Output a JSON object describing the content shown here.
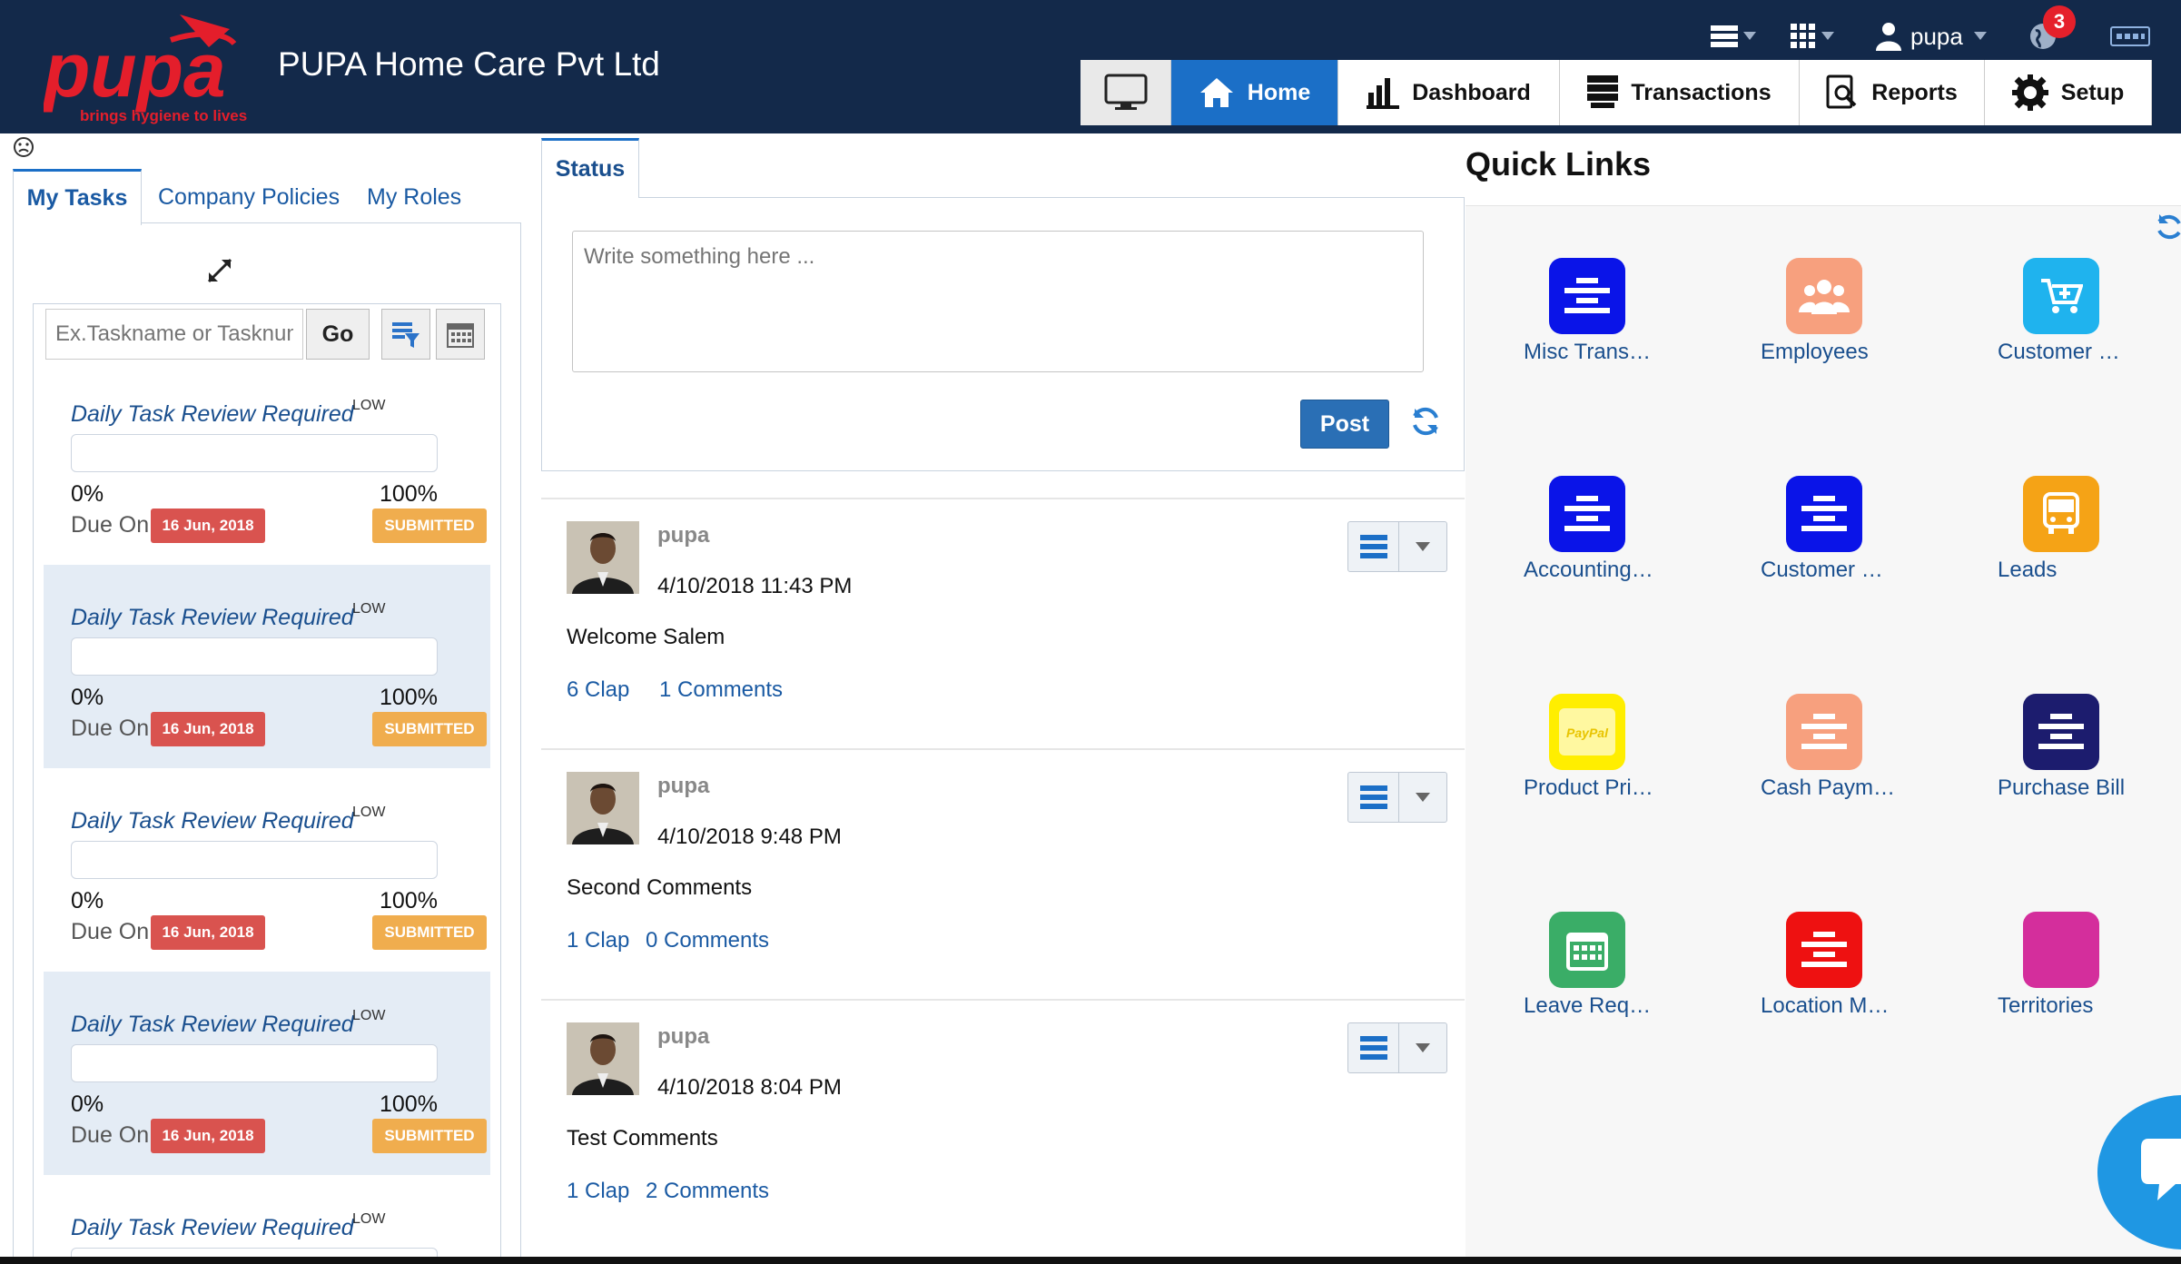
{
  "header": {
    "logo_text": "pupa",
    "logo_tagline": "brings hygiene to lives",
    "company": "PUPA Home Care Pvt Ltd",
    "username": "pupa",
    "notification_count": "3",
    "icons": [
      "list-menu-icon",
      "apps-grid-icon",
      "user-icon",
      "globe-icon",
      "keyboard-icon"
    ]
  },
  "nav": {
    "items": [
      {
        "label": "",
        "icon": "desktop-icon"
      },
      {
        "label": "Home",
        "icon": "home-icon"
      },
      {
        "label": "Dashboard",
        "icon": "bar-chart-icon"
      },
      {
        "label": "Transactions",
        "icon": "stack-icon"
      },
      {
        "label": "Reports",
        "icon": "report-search-icon"
      },
      {
        "label": "Setup",
        "icon": "gear-icon"
      }
    ],
    "active": "Home"
  },
  "left": {
    "tabs": [
      "My Tasks",
      "Company Policies",
      "My Roles"
    ],
    "search_placeholder": "Ex.Taskname or Tasknum",
    "go_label": "Go",
    "tasks": [
      {
        "title": "Daily Task Review Required",
        "priority": "LOW",
        "progress": 0,
        "min": "0%",
        "max": "100%",
        "due_label": "Due On",
        "due_date": "16 Jun, 2018",
        "status": "SUBMITTED"
      },
      {
        "title": "Daily Task Review Required",
        "priority": "LOW",
        "progress": 0,
        "min": "0%",
        "max": "100%",
        "due_label": "Due On",
        "due_date": "16 Jun, 2018",
        "status": "SUBMITTED"
      },
      {
        "title": "Daily Task Review Required",
        "priority": "LOW",
        "progress": 0,
        "min": "0%",
        "max": "100%",
        "due_label": "Due On",
        "due_date": "16 Jun, 2018",
        "status": "SUBMITTED"
      },
      {
        "title": "Daily Task Review Required",
        "priority": "LOW",
        "progress": 0,
        "min": "0%",
        "max": "100%",
        "due_label": "Due On",
        "due_date": "16 Jun, 2018",
        "status": "SUBMITTED"
      },
      {
        "title": "Daily Task Review Required",
        "priority": "LOW",
        "progress": 0,
        "min": "",
        "max": "",
        "due_label": "",
        "due_date": "",
        "status": ""
      }
    ]
  },
  "status": {
    "tab": "Status",
    "placeholder": "Write something here ...",
    "post_label": "Post",
    "posts": [
      {
        "user": "pupa",
        "time": "4/10/2018 11:43 PM",
        "text": "Welcome Salem",
        "claps": "6 Clap",
        "comments": "1 Comments"
      },
      {
        "user": "pupa",
        "time": "4/10/2018 9:48 PM",
        "text": "Second Comments",
        "claps": "1 Clap",
        "comments": "0 Comments"
      },
      {
        "user": "pupa",
        "time": "4/10/2018 8:04 PM",
        "text": "Test Comments",
        "claps": "1 Clap",
        "comments": "2 Comments"
      }
    ]
  },
  "quick_links": {
    "title": "Quick Links",
    "items": [
      {
        "label": "Misc Trans…",
        "color": "#0a14e8",
        "icon": "align-center-icon"
      },
      {
        "label": "Employees",
        "color": "#f7a07e",
        "icon": "users-icon"
      },
      {
        "label": "Customer …",
        "color": "#1fb3ee",
        "icon": "cart-icon"
      },
      {
        "label": "Accounting…",
        "color": "#0a14e8",
        "icon": "align-center-icon"
      },
      {
        "label": "Customer …",
        "color": "#0a14e8",
        "icon": "align-center-icon"
      },
      {
        "label": "Leads",
        "color": "#f5a316",
        "icon": "bus-icon"
      },
      {
        "label": "Product Pri…",
        "color": "#ffee00",
        "icon": "paypal-icon"
      },
      {
        "label": "Cash Paym…",
        "color": "#f7a07e",
        "icon": "align-center-icon"
      },
      {
        "label": "Purchase Bill",
        "color": "#1c1c6e",
        "icon": "align-center-icon"
      },
      {
        "label": "Leave Req…",
        "color": "#3aad67",
        "icon": "calendar-icon"
      },
      {
        "label": "Location M…",
        "color": "#ee1111",
        "icon": "align-center-icon"
      },
      {
        "label": "Territories",
        "color": "#d42e9c",
        "icon": "square-icon"
      }
    ]
  },
  "colors": {
    "header_bg": "#13294a",
    "accent": "#1b6fc7",
    "due_red": "#d9534f",
    "status_orange": "#f0ad4e",
    "link_blue": "#1a5aa3",
    "logo_red": "#e41e2b"
  }
}
